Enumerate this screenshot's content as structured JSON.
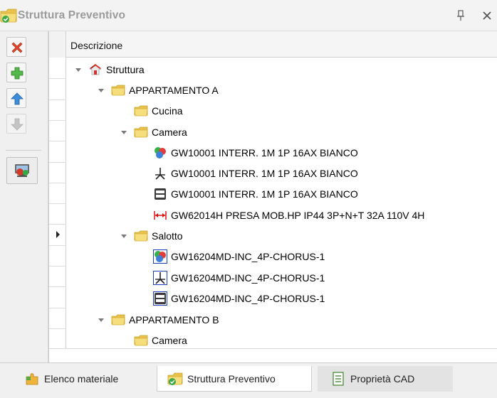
{
  "window": {
    "title": "Struttura Preventivo",
    "pin_icon": "pin-icon",
    "close_icon": "close-icon"
  },
  "toolbar": {
    "buttons": [
      {
        "name": "delete-button",
        "icon": "red-x-icon"
      },
      {
        "name": "add-button",
        "icon": "green-plus-icon"
      },
      {
        "name": "move-up-button",
        "icon": "blue-up-arrow-icon"
      },
      {
        "name": "move-down-button",
        "icon": "gray-down-arrow-icon",
        "enabled": false
      },
      {
        "name": "import-button",
        "icon": "computer-add-icon"
      }
    ]
  },
  "grid": {
    "column_header": "Descrizione",
    "focused_row_index": 8,
    "nodes": [
      {
        "label": "Struttura",
        "icon": "house-icon",
        "expanded": true,
        "level": 0
      },
      {
        "label": "APPARTAMENTO A",
        "icon": "folder-icon",
        "expanded": true,
        "level": 1
      },
      {
        "label": "Cucina",
        "icon": "folder-icon",
        "level": 2
      },
      {
        "label": "Camera",
        "icon": "folder-icon",
        "expanded": true,
        "level": 2
      },
      {
        "label": "GW10001 INTERR. 1M 1P 16AX BIANCO",
        "icon": "colored-spheres-icon",
        "level": 3
      },
      {
        "label": "GW10001 INTERR. 1M 1P 16AX BIANCO",
        "icon": "schematic-symbol-icon",
        "level": 3
      },
      {
        "label": "GW10001 INTERR. 1M 1P 16AX BIANCO",
        "icon": "outlet-box-icon",
        "level": 3
      },
      {
        "label": "GW62014H PRESA MOB.HP IP44 3P+N+T 32A 110V 4H",
        "icon": "red-dimension-icon",
        "level": 3
      },
      {
        "label": "Salotto",
        "icon": "folder-icon",
        "expanded": true,
        "level": 2
      },
      {
        "label": "GW16204MD-INC_4P-CHORUS-1",
        "icon": "colored-spheres-icon",
        "boxed": true,
        "level": 3
      },
      {
        "label": "GW16204MD-INC_4P-CHORUS-1",
        "icon": "schematic-symbol-icon",
        "boxed": true,
        "level": 3
      },
      {
        "label": "GW16204MD-INC_4P-CHORUS-1",
        "icon": "outlet-box-icon",
        "boxed": true,
        "level": 3
      },
      {
        "label": "APPARTAMENTO B",
        "icon": "folder-icon",
        "expanded": true,
        "level": 1
      },
      {
        "label": "Camera",
        "icon": "folder-icon",
        "level": 2
      }
    ]
  },
  "tabs": [
    {
      "label": "Elenco materiale",
      "icon": "puzzle-icon",
      "active": false
    },
    {
      "label": "Struttura Preventivo",
      "icon": "folder-check-icon",
      "active": true
    },
    {
      "label": "Proprietà CAD",
      "icon": "properties-list-icon",
      "active": false
    }
  ],
  "colors": {
    "title_text": "#9b9b9b",
    "folder": "#f2d36b",
    "grid_line": "#cfcfcf"
  }
}
